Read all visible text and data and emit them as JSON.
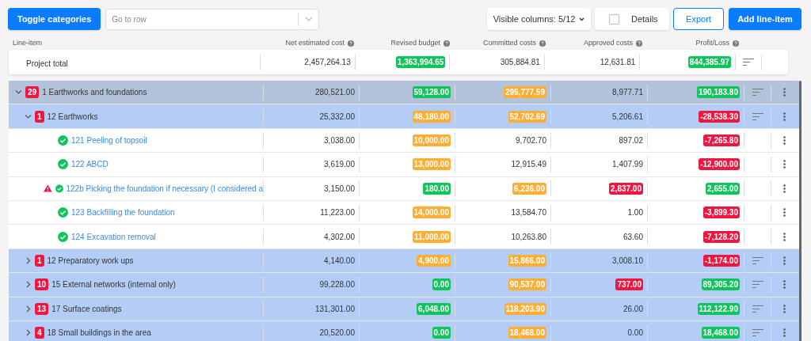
{
  "toolbar": {
    "toggle_button": "Toggle categories",
    "goto": {
      "placeholder": "Go to row"
    },
    "visible_columns": "Visible columns: 5/12",
    "details": {
      "label": "Details",
      "checked": false
    },
    "export_button": "Export",
    "add_button": "Add line-item"
  },
  "columns": [
    "Line-item",
    "Net estimated cost",
    "Revised budget",
    "Committed costs",
    "Approved costs",
    "Profit/Loss"
  ],
  "total": {
    "label": "Project total",
    "cells": [
      {
        "text": "2,457,264.13"
      },
      {
        "text": "1,363,994.65",
        "color": "#10c45c"
      },
      {
        "text": "305,884.81"
      },
      {
        "text": "12,631.81"
      },
      {
        "text": "844,385.97",
        "color": "#10c45c"
      }
    ]
  },
  "rows": [
    {
      "kind": "group",
      "label": "1 Earthworks and foundations",
      "count": "29",
      "expanded": true,
      "cells": [
        {
          "text": "280,521.00"
        },
        {
          "text": "59,128.00",
          "color": "#10c45c"
        },
        {
          "text": "295,777.59",
          "color": "#ffad33"
        },
        {
          "text": "8,977.71"
        },
        {
          "text": "190,183.80",
          "color": "#10c45c"
        }
      ],
      "children": [
        {
          "kind": "group",
          "label": "12 Earthworks",
          "count": "1",
          "expanded": true,
          "cells": [
            {
              "text": "25,332.00"
            },
            {
              "text": "48,180.00",
              "color": "#ffad33"
            },
            {
              "text": "52,702.69",
              "color": "#ffad33"
            },
            {
              "text": "5,206.61"
            },
            {
              "text": "-28,538.30",
              "color": "#f0163f"
            }
          ],
          "children": [
            {
              "kind": "item",
              "label": "121 Peeling of topsoil",
              "done": true,
              "warning": false,
              "cells": [
                {
                  "text": "3,038.00"
                },
                {
                  "text": "10,000.00",
                  "color": "#ffad33"
                },
                {
                  "text": "9,702.70"
                },
                {
                  "text": "897.02"
                },
                {
                  "text": "-7,265.80",
                  "color": "#f0163f"
                }
              ]
            },
            {
              "kind": "item",
              "label": "122 ABCD",
              "done": true,
              "warning": false,
              "cells": [
                {
                  "text": "3,619.00"
                },
                {
                  "text": "13,000.00",
                  "color": "#ffad33"
                },
                {
                  "text": "12,915.49"
                },
                {
                  "text": "1,407.99"
                },
                {
                  "text": "-12,900.00",
                  "color": "#f0163f"
                }
              ]
            },
            {
              "kind": "item",
              "label": "122b Picking the foundation if necessary (I considered a",
              "done": true,
              "warning": true,
              "cells": [
                {
                  "text": "3,150.00"
                },
                {
                  "text": "180.00",
                  "color": "#10c45c"
                },
                {
                  "text": "6,236.00",
                  "color": "#ffad33"
                },
                {
                  "text": "2,837.00",
                  "color": "#f0163f"
                },
                {
                  "text": "2,655.00",
                  "color": "#10c45c"
                }
              ]
            },
            {
              "kind": "item",
              "label": "123 Backfilling the foundation",
              "done": true,
              "warning": false,
              "cells": [
                {
                  "text": "11,223.00"
                },
                {
                  "text": "14,000.00",
                  "color": "#ffad33"
                },
                {
                  "text": "13,584.70"
                },
                {
                  "text": "1.00"
                },
                {
                  "text": "-3,899.30",
                  "color": "#f0163f"
                }
              ]
            },
            {
              "kind": "item",
              "label": "124 Excavation removal",
              "done": true,
              "warning": false,
              "cells": [
                {
                  "text": "4,302.00"
                },
                {
                  "text": "11,000.00",
                  "color": "#ffad33"
                },
                {
                  "text": "10,263.80"
                },
                {
                  "text": "63.60"
                },
                {
                  "text": "-7,128.20",
                  "color": "#f0163f"
                }
              ]
            }
          ]
        },
        {
          "kind": "group",
          "label": "12 Preparatory work ups",
          "count": "1",
          "expanded": false,
          "cells": [
            {
              "text": "4,140.00"
            },
            {
              "text": "4,900.00",
              "color": "#ffad33"
            },
            {
              "text": "15,866.00",
              "color": "#ffad33"
            },
            {
              "text": "3,008.10"
            },
            {
              "text": "-1,174.00",
              "color": "#f0163f"
            }
          ]
        },
        {
          "kind": "group",
          "label": "15 External networks (internal only)",
          "count": "10",
          "expanded": false,
          "cells": [
            {
              "text": "99,228.00"
            },
            {
              "text": "0.00",
              "color": "#10c45c"
            },
            {
              "text": "90,537.00",
              "color": "#ffad33"
            },
            {
              "text": "737.00",
              "color": "#f0163f"
            },
            {
              "text": "89,305.20",
              "color": "#10c45c"
            }
          ]
        },
        {
          "kind": "group",
          "label": "17 Surface coatings",
          "count": "13",
          "expanded": false,
          "cells": [
            {
              "text": "131,301.00"
            },
            {
              "text": "6,048.00",
              "color": "#10c45c"
            },
            {
              "text": "118,203.90",
              "color": "#ffad33"
            },
            {
              "text": "26.00"
            },
            {
              "text": "112,122.90",
              "color": "#10c45c"
            }
          ]
        },
        {
          "kind": "group",
          "label": "18 Small buildings in the area",
          "count": "4",
          "expanded": false,
          "cells": [
            {
              "text": "20,520.00"
            },
            {
              "text": "0.00",
              "color": "#10c45c"
            },
            {
              "text": "18,468.00",
              "color": "#ffad33"
            },
            {
              "text": "0.00"
            },
            {
              "text": "18,468.00",
              "color": "#10c45c"
            }
          ]
        }
      ]
    }
  ]
}
